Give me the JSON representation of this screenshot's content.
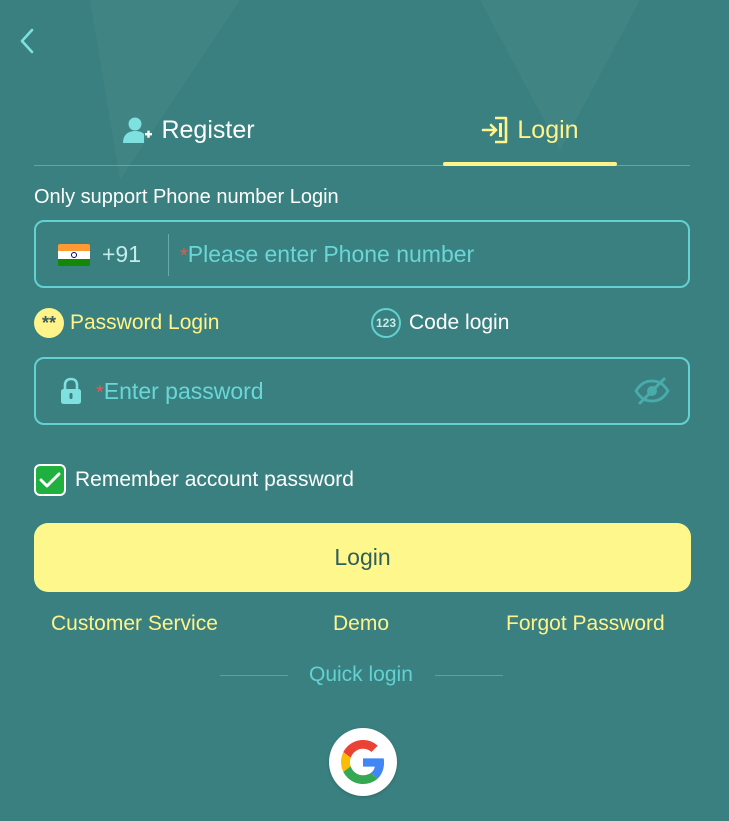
{
  "tabs": [
    {
      "label": "Register",
      "icon": "add-user-icon",
      "active": false
    },
    {
      "label": "Login",
      "icon": "login-door-icon",
      "active": true
    }
  ],
  "hint": "Only support Phone number Login",
  "phone": {
    "country_flag": "india-flag-icon",
    "country_code": "+91",
    "required_mark": "*",
    "placeholder": "Please enter Phone number"
  },
  "login_modes": [
    {
      "label": "Password Login",
      "icon_text": "**",
      "active": true
    },
    {
      "label": "Code login",
      "icon_text": "123",
      "active": false
    }
  ],
  "password": {
    "required_mark": "*",
    "placeholder": "Enter password"
  },
  "remember": {
    "label": "Remember account password",
    "checked": true
  },
  "login_button": "Login",
  "links": {
    "customer_service": "Customer Service",
    "demo": "Demo",
    "forgot_password": "Forgot Password"
  },
  "quick_login_label": "Quick login",
  "colors": {
    "background": "#3a8080",
    "accent": "#fff38a",
    "border": "#63d1d1",
    "checkbox": "#20b040"
  }
}
